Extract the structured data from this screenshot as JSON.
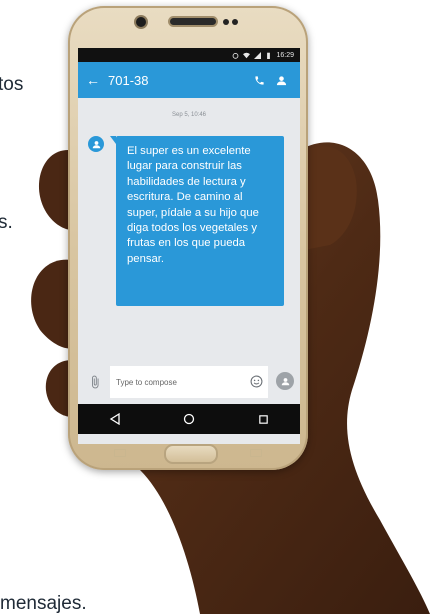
{
  "page": {
    "fragment_top": "tos",
    "fragment_middle": "s.",
    "fragment_bottom": "mensajes."
  },
  "status_bar": {
    "time": "16:29"
  },
  "app_bar": {
    "back_icon": "arrow-left-icon",
    "title": "701-38",
    "call_icon": "phone-icon",
    "contact_icon": "person-icon"
  },
  "conversation": {
    "date_stamp": "Sep 5, 10:46",
    "messages": [
      {
        "text": "El super es un excelente lugar para construir las habilidades de lectura y escritura. De camino al super, pídale a su hijo que diga todos los vegetales y frutas en los que pueda pensar."
      }
    ]
  },
  "composer": {
    "placeholder": "Type to compose",
    "value": ""
  },
  "colors": {
    "accent": "#2a98d8",
    "screen_bg": "#e7e9ec",
    "phone_body": "#d9c6a2"
  }
}
